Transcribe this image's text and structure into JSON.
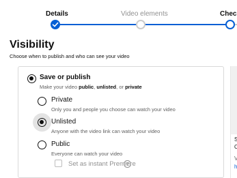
{
  "stepper": {
    "steps": [
      {
        "label": "Details"
      },
      {
        "label": "Video elements"
      },
      {
        "label": "Checks"
      }
    ]
  },
  "colors": {
    "accent": "#065fd4",
    "inactive": "#cccccc"
  },
  "visibility": {
    "title": "Visibility",
    "subtitle": "Choose when to publish and who can see your video"
  },
  "save_or_publish": {
    "title": "Save or publish",
    "desc_prefix": "Make your video ",
    "desc_public": "public",
    "desc_sep1": ", ",
    "desc_unlisted": "unlisted",
    "desc_sep2": ", or ",
    "desc_private": "private",
    "selected": true
  },
  "options": [
    {
      "title": "Private",
      "desc": "Only you and people you choose can watch your video",
      "selected": false
    },
    {
      "title": "Unlisted",
      "desc": "Anyone with the video link can watch your video",
      "selected": true
    },
    {
      "title": "Public",
      "desc": "Everyone can watch your video",
      "selected": false
    }
  ],
  "premiere": {
    "label": "Set as instant Premiere",
    "checked": false,
    "help_glyph": "?"
  },
  "side_panel": {
    "fragments": [
      "S",
      "C",
      "V",
      "h"
    ]
  }
}
